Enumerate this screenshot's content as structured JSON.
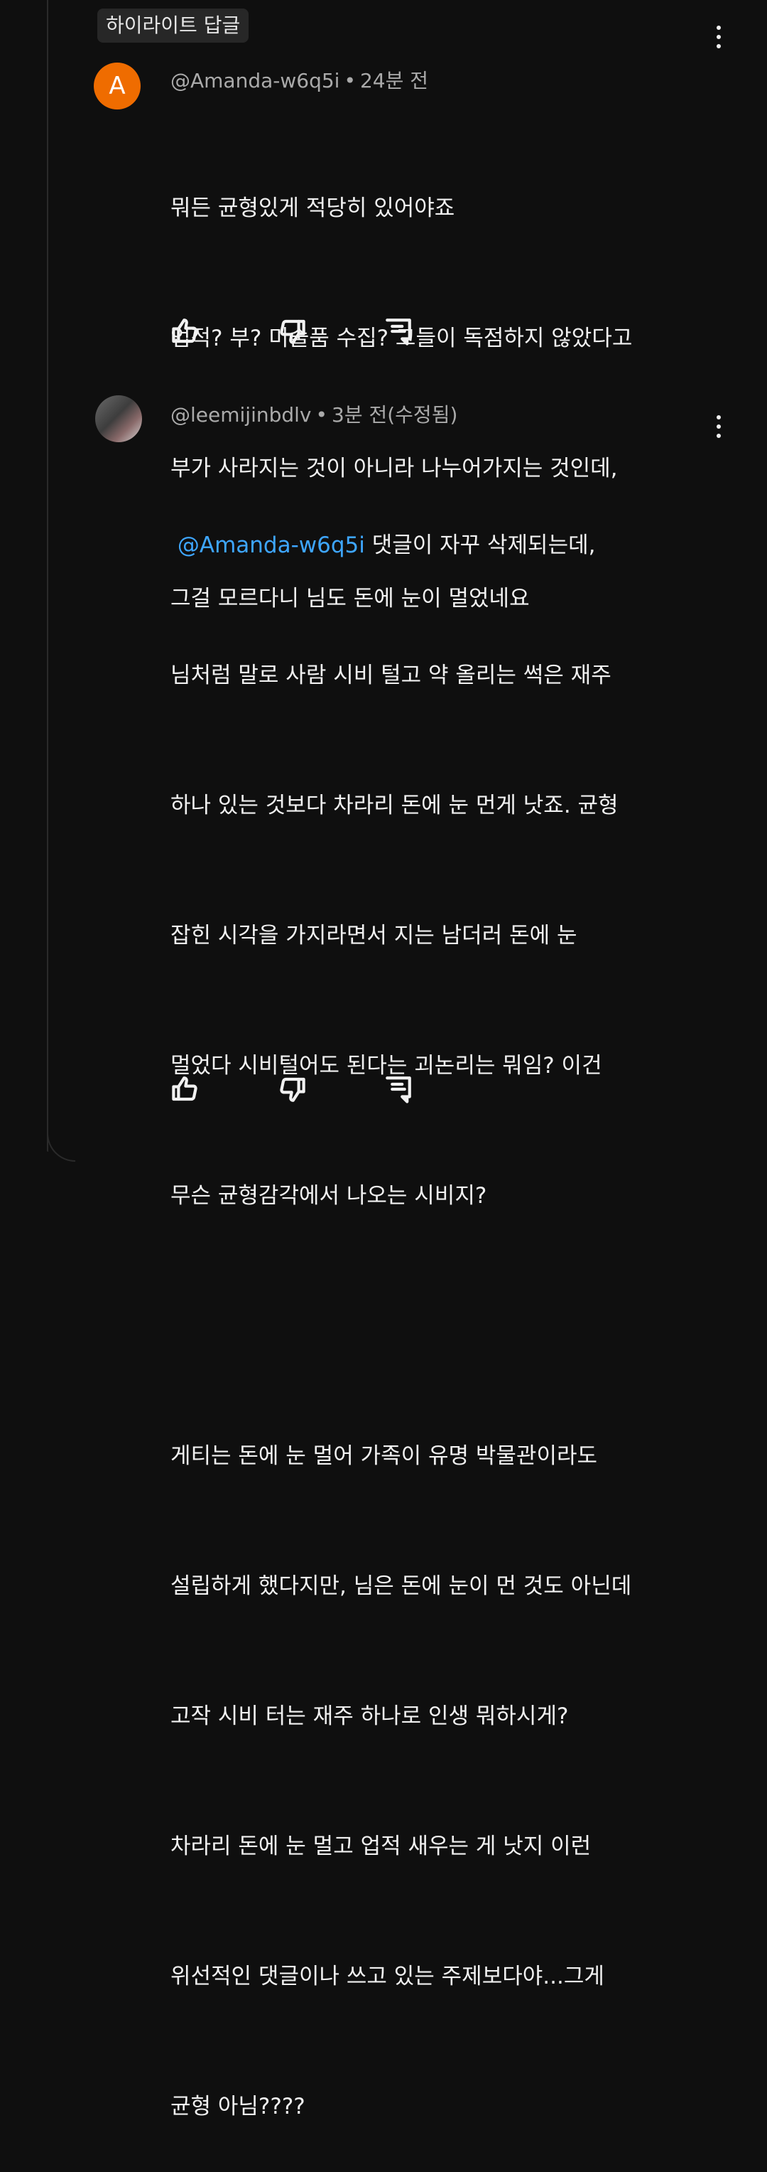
{
  "highlight_chip": "하이라이트 답글",
  "comments": [
    {
      "avatar_letter": "A",
      "author": "@Amanda-w6q5i",
      "time": "24분 전",
      "lines": [
        "뭐든 균형있게 적당히 있어야죠",
        "업적? 부? 미술품 수집? 그들이 독점하지 않았다고",
        "부가 사라지는 것이 아니라 나누어가지는 것인데,",
        "그걸 모르다니 님도 돈에 눈이 멀었네요"
      ]
    },
    {
      "author": "@leemijinbdlv",
      "time": "3분 전(수정됨)",
      "mention": "@Amanda-w6q5i",
      "first_line_rest": " 댓글이 자꾸 삭제되는데,",
      "lines": [
        "님처럼 말로 사람 시비 털고 약 올리는 썩은 재주",
        "하나 있는 것보다 차라리 돈에 눈 먼게 낫죠. 균형",
        "잡힌 시각을 가지라면서 지는 남더러 돈에 눈",
        "멀었다 시비털어도 된다는 괴논리는 뭐임? 이건",
        "무슨 균형감각에서 나오는 시비지?",
        "",
        "게티는 돈에 눈 멀어 가족이 유명 박물관이라도",
        "설립하게 했다지만, 님은 돈에 눈이 먼 것도 아닌데",
        "고작 시비 터는 재주 하나로 인생 뭐하시게?",
        "차라리 돈에 눈 멀고 업적 새우는 게 낫지 이런",
        "위선적인 댓글이나 쓰고 있는 주제보다야...그게",
        "균형 아님????"
      ]
    }
  ],
  "icons": [
    "like-icon",
    "dislike-icon",
    "reply-icon",
    "more-vert-icon"
  ]
}
